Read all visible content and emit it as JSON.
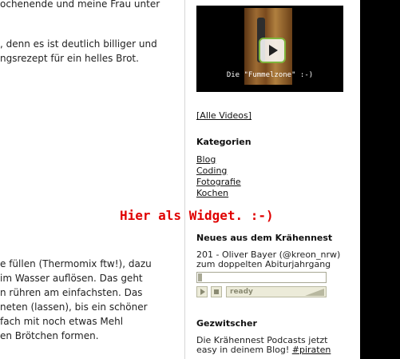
{
  "main": {
    "para1": [
      "ochenende und meine Frau unter"
    ],
    "para2": [
      ", denn es ist deutlich billiger und",
      "ngsrezept für ein helles Brot."
    ],
    "para3": [
      "e füllen (Thermomix ftw!), dazu",
      "im Wasser auflösen. Das geht",
      "n rühren am einfachsten. Das",
      "neten (lassen), bis ein schöner",
      "fach mit noch etwas Mehl",
      "en Brötchen formen."
    ]
  },
  "sidebar": {
    "video_caption": "Die \"Fummelzone\" :-)",
    "all_videos_label": "[Alle Videos]",
    "kategorien_heading": "Kategorien",
    "categories": [
      "Blog",
      "Coding",
      "Fotografie",
      "Kochen"
    ],
    "neues_heading": "Neues aus dem Krähennest",
    "episode_title_line1": "201 - Oliver Bayer (@kreon_nrw)",
    "episode_title_line2": "zum doppelten Abiturjahrgang",
    "player_status": "ready",
    "gezwitscher_heading": "Gezwitscher",
    "tweet_line1": "Die Krähennest Podcasts jetzt",
    "tweet_line2_text": "easy in deinem Blog! ",
    "tweet_hashtag": "#piraten"
  },
  "annotation": "Hier als Widget. :-)",
  "player": {
    "progress": 0.0
  },
  "colors": {
    "annotation": "#e00000",
    "player_bg": "#ecebd9",
    "play_border": "#7eb53c"
  }
}
